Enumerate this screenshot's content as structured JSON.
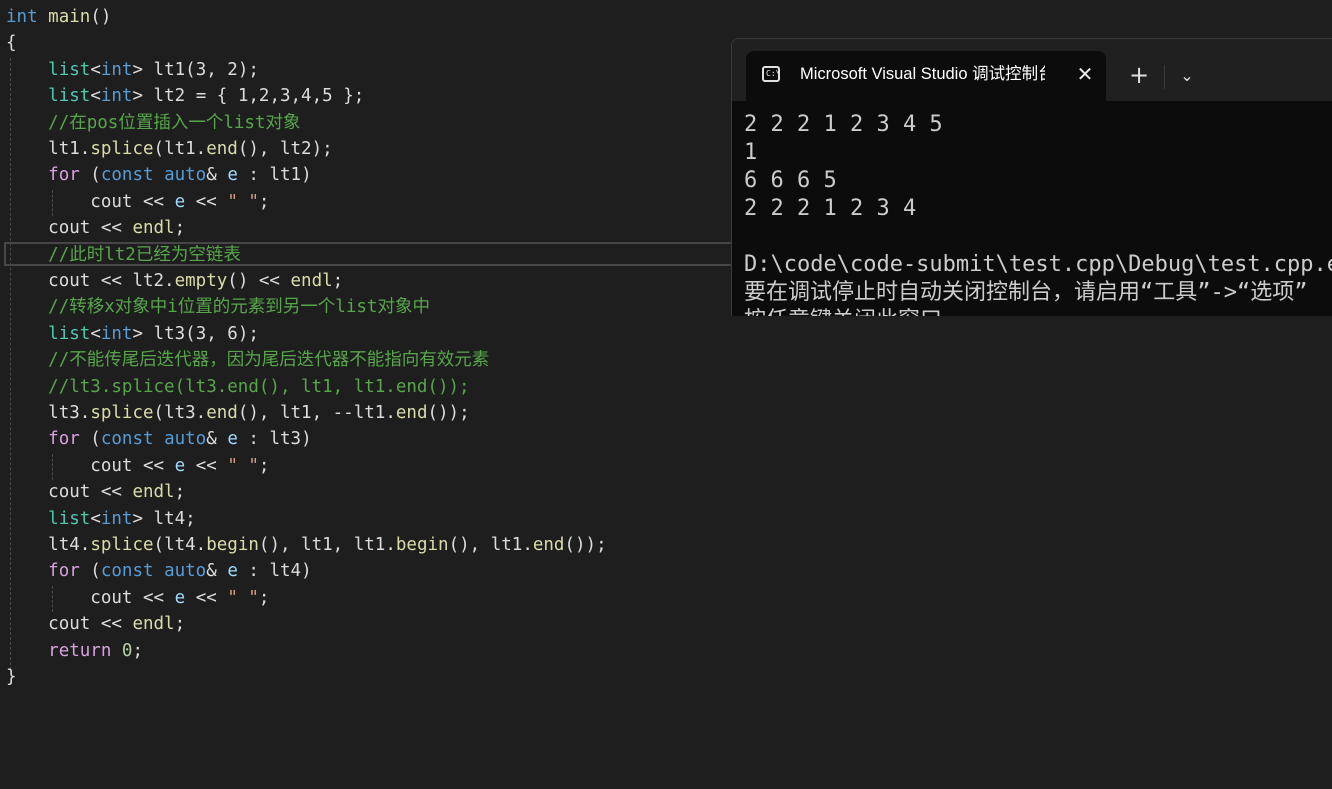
{
  "editor": {
    "lines": [
      {
        "parts": [
          {
            "t": "int",
            "c": "kw"
          },
          {
            "t": " ",
            "c": ""
          },
          {
            "t": "main",
            "c": "fn"
          },
          {
            "t": "()",
            "c": ""
          }
        ]
      },
      {
        "parts": [
          {
            "t": "{",
            "c": ""
          }
        ]
      },
      {
        "parts": [
          {
            "t": "    ",
            "c": ""
          },
          {
            "t": "list",
            "c": "ty"
          },
          {
            "t": "<",
            "c": ""
          },
          {
            "t": "int",
            "c": "kw"
          },
          {
            "t": "> ",
            "c": ""
          },
          {
            "t": "lt1",
            "c": ""
          },
          {
            "t": "(3, 2);",
            "c": ""
          }
        ]
      },
      {
        "parts": [
          {
            "t": "    ",
            "c": ""
          },
          {
            "t": "list",
            "c": "ty"
          },
          {
            "t": "<",
            "c": ""
          },
          {
            "t": "int",
            "c": "kw"
          },
          {
            "t": "> ",
            "c": ""
          },
          {
            "t": "lt2 = { 1,2,3,4,5 };",
            "c": ""
          }
        ]
      },
      {
        "parts": [
          {
            "t": "    ",
            "c": ""
          },
          {
            "t": "//在pos位置插入一个list对象",
            "c": "cm"
          }
        ]
      },
      {
        "parts": [
          {
            "t": "    ",
            "c": ""
          },
          {
            "t": "lt1.",
            "c": ""
          },
          {
            "t": "splice",
            "c": "fn"
          },
          {
            "t": "(lt1.",
            "c": ""
          },
          {
            "t": "end",
            "c": "fn"
          },
          {
            "t": "(), lt2);",
            "c": ""
          }
        ]
      },
      {
        "parts": [
          {
            "t": "    ",
            "c": ""
          },
          {
            "t": "for",
            "c": "kw2"
          },
          {
            "t": " (",
            "c": ""
          },
          {
            "t": "const",
            "c": "kw"
          },
          {
            "t": " ",
            "c": ""
          },
          {
            "t": "auto",
            "c": "kw"
          },
          {
            "t": "& ",
            "c": ""
          },
          {
            "t": "e",
            "c": "var"
          },
          {
            "t": " : lt1)",
            "c": ""
          }
        ]
      },
      {
        "parts": [
          {
            "t": "        ",
            "c": ""
          },
          {
            "t": "cout",
            "c": ""
          },
          {
            "t": " << ",
            "c": ""
          },
          {
            "t": "e",
            "c": "var"
          },
          {
            "t": " << ",
            "c": ""
          },
          {
            "t": "\" \"",
            "c": "str"
          },
          {
            "t": ";",
            "c": ""
          }
        ]
      },
      {
        "parts": [
          {
            "t": "    ",
            "c": ""
          },
          {
            "t": "cout << ",
            "c": ""
          },
          {
            "t": "endl",
            "c": "fn"
          },
          {
            "t": ";",
            "c": ""
          }
        ]
      },
      {
        "parts": [
          {
            "t": "    ",
            "c": ""
          },
          {
            "t": "//此时lt2已经为空链表",
            "c": "cm"
          }
        ]
      },
      {
        "parts": [
          {
            "t": "    ",
            "c": ""
          },
          {
            "t": "cout << lt2.",
            "c": ""
          },
          {
            "t": "empty",
            "c": "fn"
          },
          {
            "t": "() << ",
            "c": ""
          },
          {
            "t": "endl",
            "c": "fn"
          },
          {
            "t": ";",
            "c": ""
          }
        ]
      },
      {
        "parts": [
          {
            "t": "    ",
            "c": ""
          },
          {
            "t": "//转移x对象中i位置的元素到另一个list对象中",
            "c": "cm"
          }
        ]
      },
      {
        "parts": [
          {
            "t": "    ",
            "c": ""
          },
          {
            "t": "list",
            "c": "ty"
          },
          {
            "t": "<",
            "c": ""
          },
          {
            "t": "int",
            "c": "kw"
          },
          {
            "t": "> ",
            "c": ""
          },
          {
            "t": "lt3",
            "c": ""
          },
          {
            "t": "(3, 6);",
            "c": ""
          }
        ]
      },
      {
        "parts": [
          {
            "t": "    ",
            "c": ""
          },
          {
            "t": "//不能传尾后迭代器，因为尾后迭代器不能指向有效元素",
            "c": "cm"
          }
        ]
      },
      {
        "parts": [
          {
            "t": "    ",
            "c": ""
          },
          {
            "t": "//lt3.splice(lt3.end(), lt1, lt1.end());",
            "c": "cm"
          }
        ]
      },
      {
        "parts": [
          {
            "t": "    ",
            "c": ""
          },
          {
            "t": "lt3.",
            "c": ""
          },
          {
            "t": "splice",
            "c": "fn"
          },
          {
            "t": "(lt3.",
            "c": ""
          },
          {
            "t": "end",
            "c": "fn"
          },
          {
            "t": "(), lt1, --lt1.",
            "c": ""
          },
          {
            "t": "end",
            "c": "fn"
          },
          {
            "t": "());",
            "c": ""
          }
        ]
      },
      {
        "parts": [
          {
            "t": "    ",
            "c": ""
          },
          {
            "t": "for",
            "c": "kw2"
          },
          {
            "t": " (",
            "c": ""
          },
          {
            "t": "const",
            "c": "kw"
          },
          {
            "t": " ",
            "c": ""
          },
          {
            "t": "auto",
            "c": "kw"
          },
          {
            "t": "& ",
            "c": ""
          },
          {
            "t": "e",
            "c": "var"
          },
          {
            "t": " : lt3)",
            "c": ""
          }
        ]
      },
      {
        "parts": [
          {
            "t": "        ",
            "c": ""
          },
          {
            "t": "cout",
            "c": ""
          },
          {
            "t": " << ",
            "c": ""
          },
          {
            "t": "e",
            "c": "var"
          },
          {
            "t": " << ",
            "c": ""
          },
          {
            "t": "\" \"",
            "c": "str"
          },
          {
            "t": ";",
            "c": ""
          }
        ]
      },
      {
        "parts": [
          {
            "t": "    ",
            "c": ""
          },
          {
            "t": "cout << ",
            "c": ""
          },
          {
            "t": "endl",
            "c": "fn"
          },
          {
            "t": ";",
            "c": ""
          }
        ]
      },
      {
        "parts": [
          {
            "t": "    ",
            "c": ""
          },
          {
            "t": "list",
            "c": "ty"
          },
          {
            "t": "<",
            "c": ""
          },
          {
            "t": "int",
            "c": "kw"
          },
          {
            "t": "> ",
            "c": ""
          },
          {
            "t": "lt4;",
            "c": ""
          }
        ]
      },
      {
        "parts": [
          {
            "t": "    ",
            "c": ""
          },
          {
            "t": "lt4.",
            "c": ""
          },
          {
            "t": "splice",
            "c": "fn"
          },
          {
            "t": "(lt4.",
            "c": ""
          },
          {
            "t": "begin",
            "c": "fn"
          },
          {
            "t": "(), lt1, lt1.",
            "c": ""
          },
          {
            "t": "begin",
            "c": "fn"
          },
          {
            "t": "(), lt1.",
            "c": ""
          },
          {
            "t": "end",
            "c": "fn"
          },
          {
            "t": "());",
            "c": ""
          }
        ]
      },
      {
        "parts": [
          {
            "t": "    ",
            "c": ""
          },
          {
            "t": "for",
            "c": "kw2"
          },
          {
            "t": " (",
            "c": ""
          },
          {
            "t": "const",
            "c": "kw"
          },
          {
            "t": " ",
            "c": ""
          },
          {
            "t": "auto",
            "c": "kw"
          },
          {
            "t": "& ",
            "c": ""
          },
          {
            "t": "e",
            "c": "var"
          },
          {
            "t": " : lt4)",
            "c": ""
          }
        ]
      },
      {
        "parts": [
          {
            "t": "        ",
            "c": ""
          },
          {
            "t": "cout",
            "c": ""
          },
          {
            "t": " << ",
            "c": ""
          },
          {
            "t": "e",
            "c": "var"
          },
          {
            "t": " << ",
            "c": ""
          },
          {
            "t": "\" \"",
            "c": "str"
          },
          {
            "t": ";",
            "c": ""
          }
        ]
      },
      {
        "parts": [
          {
            "t": "    ",
            "c": ""
          },
          {
            "t": "cout << ",
            "c": ""
          },
          {
            "t": "endl",
            "c": "fn"
          },
          {
            "t": ";",
            "c": ""
          }
        ]
      },
      {
        "parts": [
          {
            "t": "    ",
            "c": ""
          },
          {
            "t": "return",
            "c": "kw2"
          },
          {
            "t": " ",
            "c": ""
          },
          {
            "t": "0",
            "c": "num"
          },
          {
            "t": ";",
            "c": ""
          }
        ]
      },
      {
        "parts": [
          {
            "t": "}",
            "c": ""
          }
        ]
      }
    ]
  },
  "console": {
    "tab_title": "Microsoft Visual Studio 调试控制台",
    "tab_icon_text": "C:\\",
    "close_glyph": "✕",
    "new_tab_glyph": "+",
    "dropdown_glyph": "⌄",
    "output": [
      "2 2 2 1 2 3 4 5",
      "1",
      "6 6 6 5",
      "2 2 2 1 2 3 4",
      "",
      "D:\\code\\code-submit\\test.cpp\\Debug\\test.cpp.exe",
      "要在调试停止时自动关闭控制台，请启用“工具”->“选项”",
      "按任意键关闭此窗口. . ."
    ]
  }
}
